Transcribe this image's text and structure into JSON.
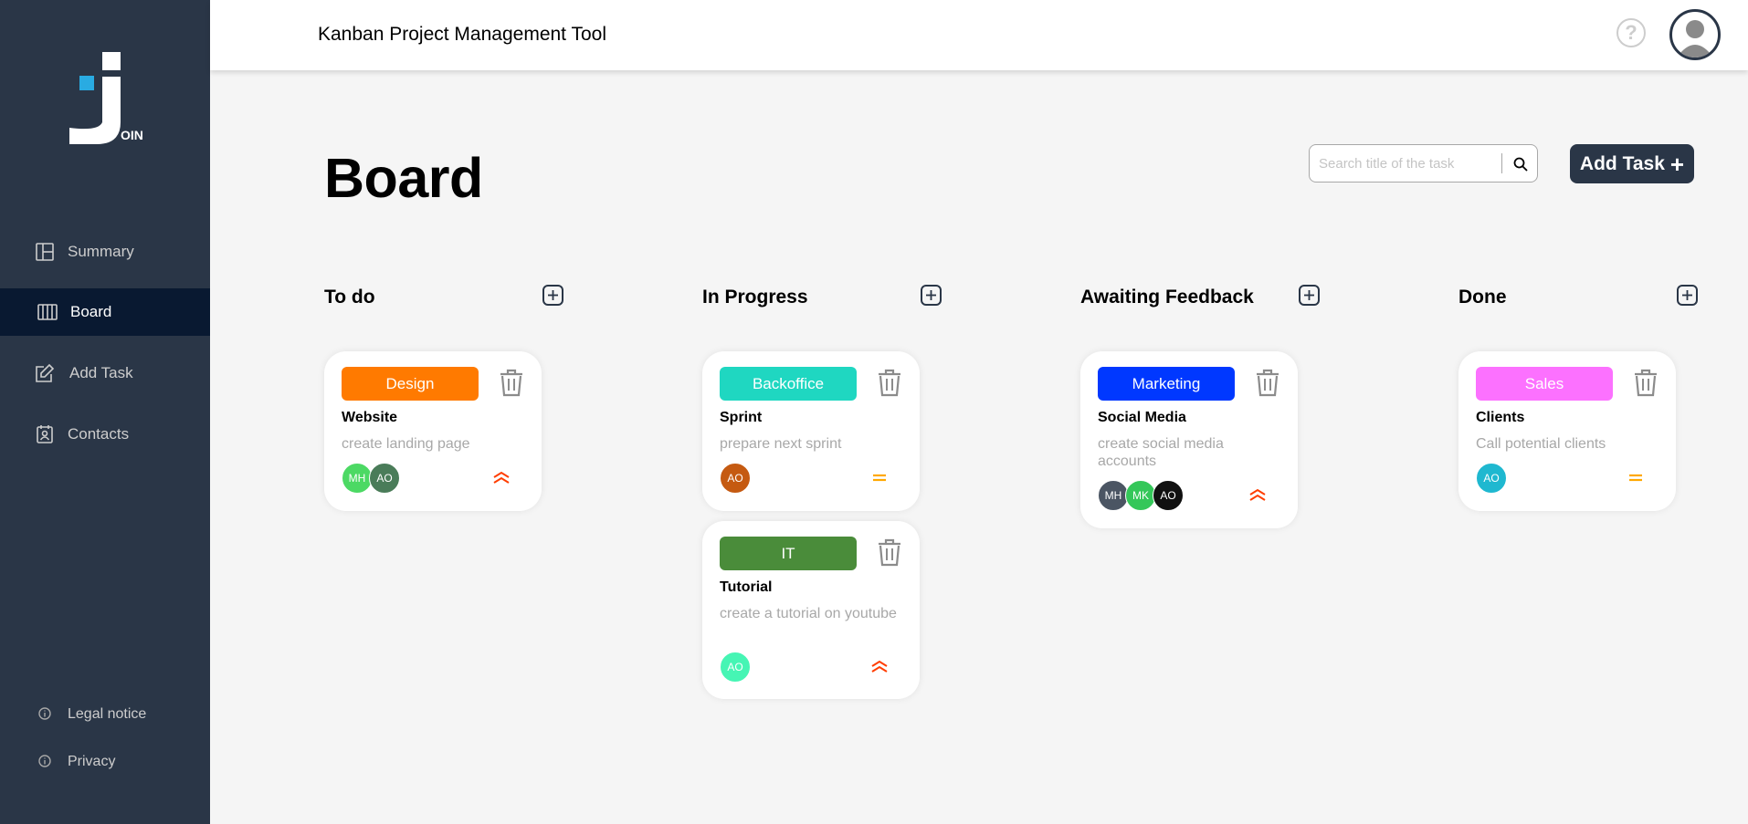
{
  "app": {
    "title": "Kanban Project Management Tool",
    "logo_text": "OIN"
  },
  "sidebar": {
    "items": [
      {
        "label": "Summary",
        "icon": "summary-icon"
      },
      {
        "label": "Board",
        "icon": "board-icon",
        "active": true
      },
      {
        "label": "Add Task",
        "icon": "add-task-icon"
      },
      {
        "label": "Contacts",
        "icon": "contacts-icon"
      }
    ],
    "footer": [
      {
        "label": "Legal notice",
        "icon": "info-icon"
      },
      {
        "label": "Privacy",
        "icon": "info-icon"
      }
    ]
  },
  "header": {
    "help_symbol": "?"
  },
  "board": {
    "title": "Board",
    "search_placeholder": "Search title of the task",
    "add_task_label": "Add Task",
    "add_task_symbol": "+"
  },
  "columns": [
    {
      "title": "To do",
      "cards": [
        {
          "category": "Design",
          "category_color": "#ff7a00",
          "title": "Website",
          "description": "create landing page",
          "members": [
            {
              "initials": "MH",
              "color": "#4cd964"
            },
            {
              "initials": "AO",
              "color": "#4a7c59"
            }
          ],
          "priority": "urgent"
        }
      ]
    },
    {
      "title": "In Progress",
      "cards": [
        {
          "category": "Backoffice",
          "category_color": "#1fd7c1",
          "title": "Sprint",
          "description": "prepare next sprint",
          "members": [
            {
              "initials": "AO",
              "color": "#c55a11"
            }
          ],
          "priority": "medium"
        },
        {
          "category": "IT",
          "category_color": "#4a8c3a",
          "title": "Tutorial",
          "description": "create a tutorial on youtube",
          "members": [
            {
              "initials": "AO",
              "color": "#46f5b4"
            }
          ],
          "priority": "urgent"
        }
      ]
    },
    {
      "title": "Awaiting Feedback",
      "cards": [
        {
          "category": "Marketing",
          "category_color": "#0038ff",
          "title": "Social Media",
          "description": "create social media accounts",
          "members": [
            {
              "initials": "MH",
              "color": "#4b5563"
            },
            {
              "initials": "MK",
              "color": "#34c759"
            },
            {
              "initials": "AO",
              "color": "#111111"
            }
          ],
          "priority": "urgent"
        }
      ]
    },
    {
      "title": "Done",
      "cards": [
        {
          "category": "Sales",
          "category_color": "#fc71ff",
          "title": "Clients",
          "description": "Call potential clients",
          "members": [
            {
              "initials": "AO",
              "color": "#1fb8d0"
            }
          ],
          "priority": "medium"
        }
      ]
    }
  ],
  "colors": {
    "sidebar": "#2a3647",
    "active_nav": "#091931",
    "urgent": "#ff3d00",
    "medium": "#ffa800"
  }
}
